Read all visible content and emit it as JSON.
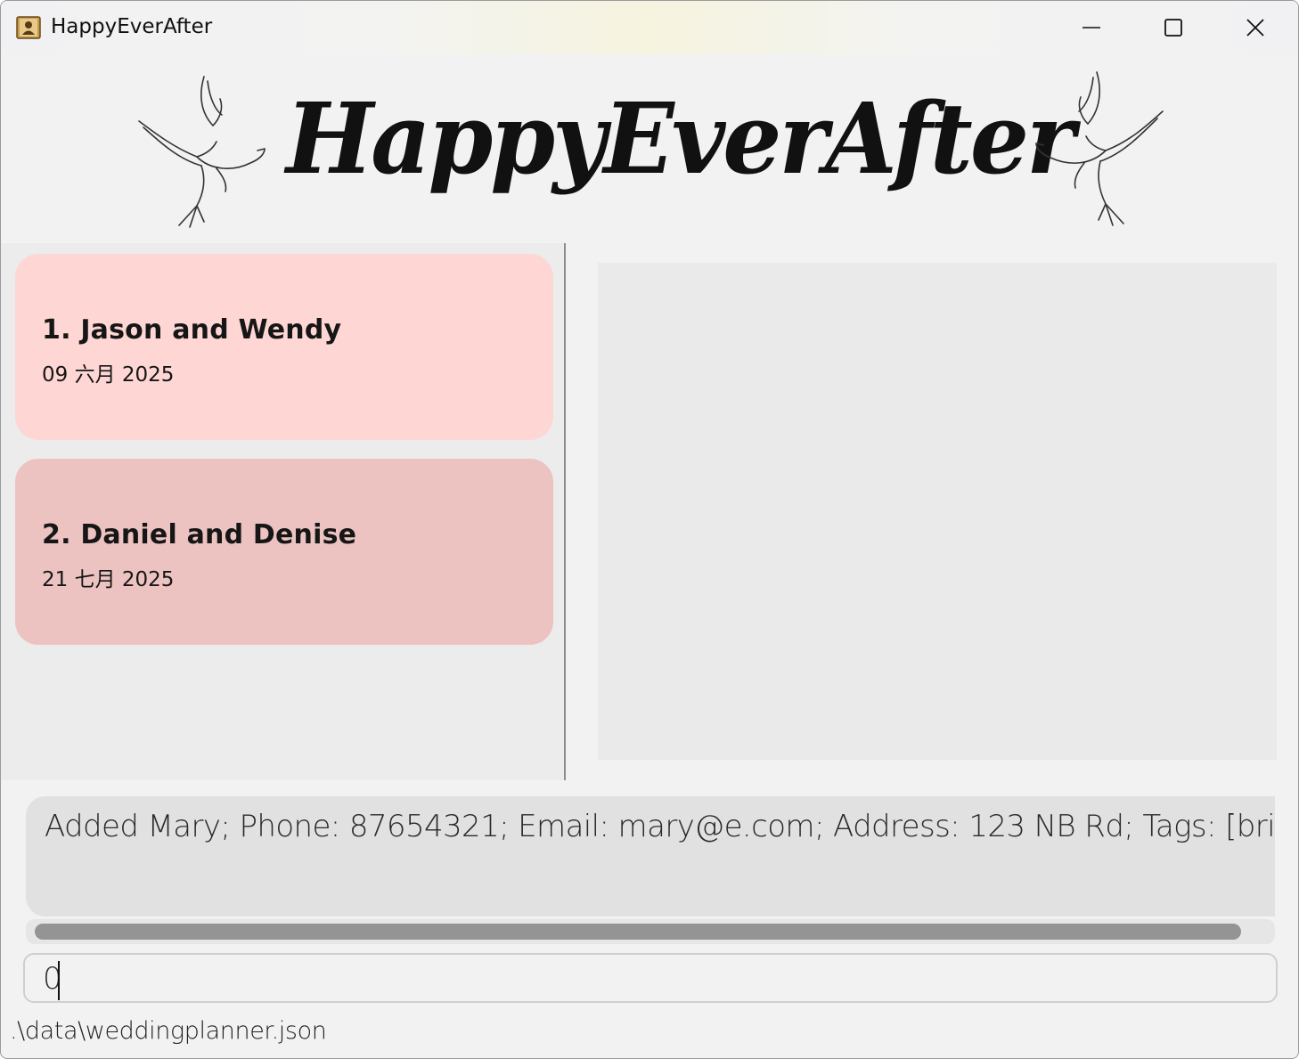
{
  "window": {
    "title": "HappyEverAfter",
    "buttons": [
      "minimize",
      "maximize",
      "close"
    ]
  },
  "banner": {
    "title": "HappyEverAfter"
  },
  "weddings": [
    {
      "name": "1. Jason and Wendy",
      "date": "09 六月 2025",
      "color": "#fed7d5"
    },
    {
      "name": "2. Daniel and Denise",
      "date": "21 七月 2025",
      "color": "#edc3c2"
    }
  ],
  "result": {
    "text": "Added Mary; Phone: 87654321; Email: mary@e.com; Address: 123 NB Rd; Tags: [bride] as BRIDE",
    "scroll_fraction_visible": 0.98
  },
  "command": {
    "value": "0"
  },
  "status": {
    "path": ".\\data\\weddingplanner.json"
  },
  "colors": {
    "accent_card_1": "#fed7d5",
    "accent_card_2": "#edc3c2",
    "background": "#f2f2f2"
  }
}
